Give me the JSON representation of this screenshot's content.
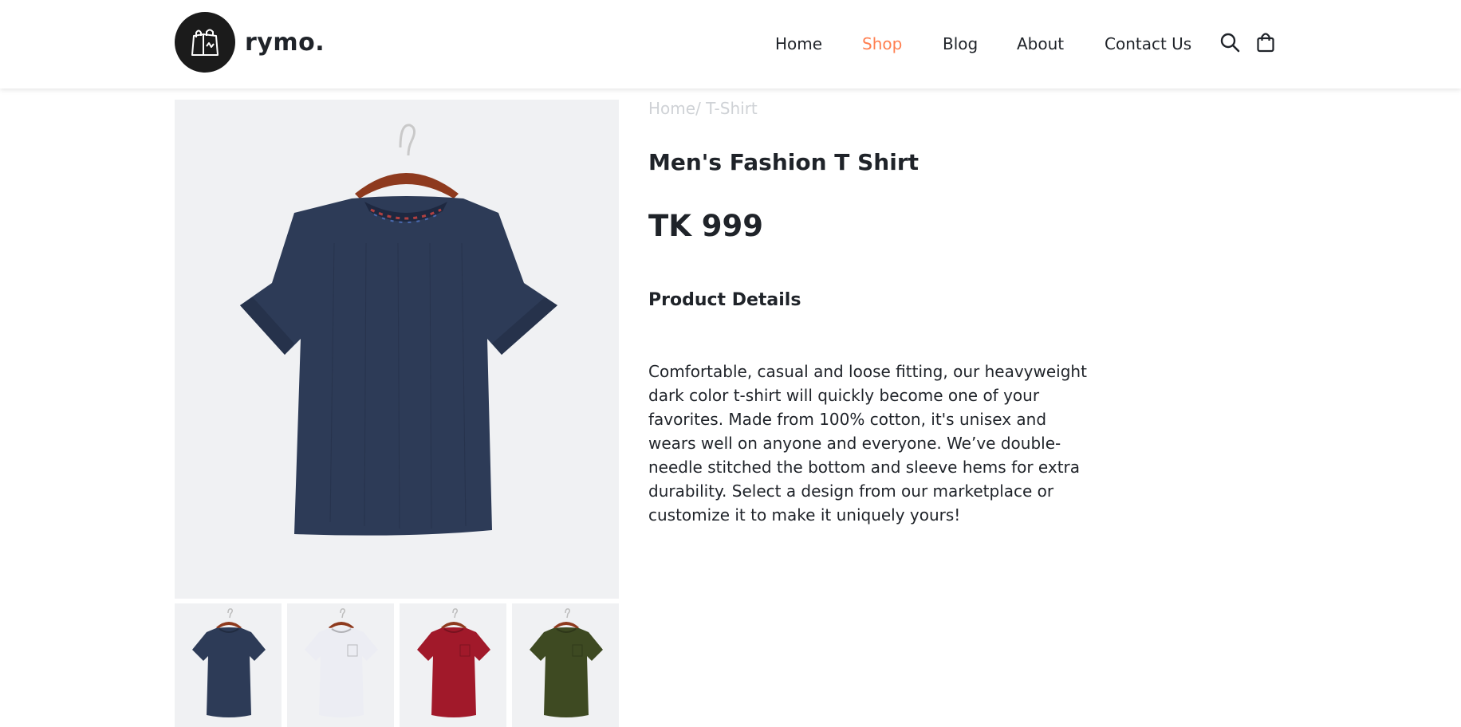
{
  "brand": {
    "name": "rymo."
  },
  "nav": {
    "items": [
      {
        "label": "Home",
        "active": false
      },
      {
        "label": "Shop",
        "active": true
      },
      {
        "label": "Blog",
        "active": false
      },
      {
        "label": "About",
        "active": false
      },
      {
        "label": "Contact Us",
        "active": false
      }
    ],
    "icons": [
      "search-icon",
      "shopping-bag-icon"
    ]
  },
  "breadcrumb": {
    "home": "Home",
    "separator": "/",
    "current": "T-Shirt"
  },
  "product": {
    "title": "Men's Fashion T Shirt",
    "price": "TK 999",
    "details_heading": "Product Details",
    "description": "Comfortable, casual and loose fitting, our heavyweight dark color t-shirt will quickly become one of your favorites. Made from 100% cotton, it's unisex and wears well on anyone and everyone. We’ve double-needle stitched the bottom and sleeve hems for extra durability. Select a design from our marketplace or customize it to make it uniquely yours!"
  },
  "gallery": {
    "main_color": "#2d3b57",
    "thumbnails": [
      {
        "color": "#2d3b57"
      },
      {
        "color": "#ecedf3"
      },
      {
        "color": "#a1192a"
      },
      {
        "color": "#3e4a22"
      }
    ]
  },
  "colors": {
    "accent": "#ff7f50",
    "text": "#1f2329",
    "muted": "#cfd2d6",
    "image_bg": "#f0f1f3"
  }
}
